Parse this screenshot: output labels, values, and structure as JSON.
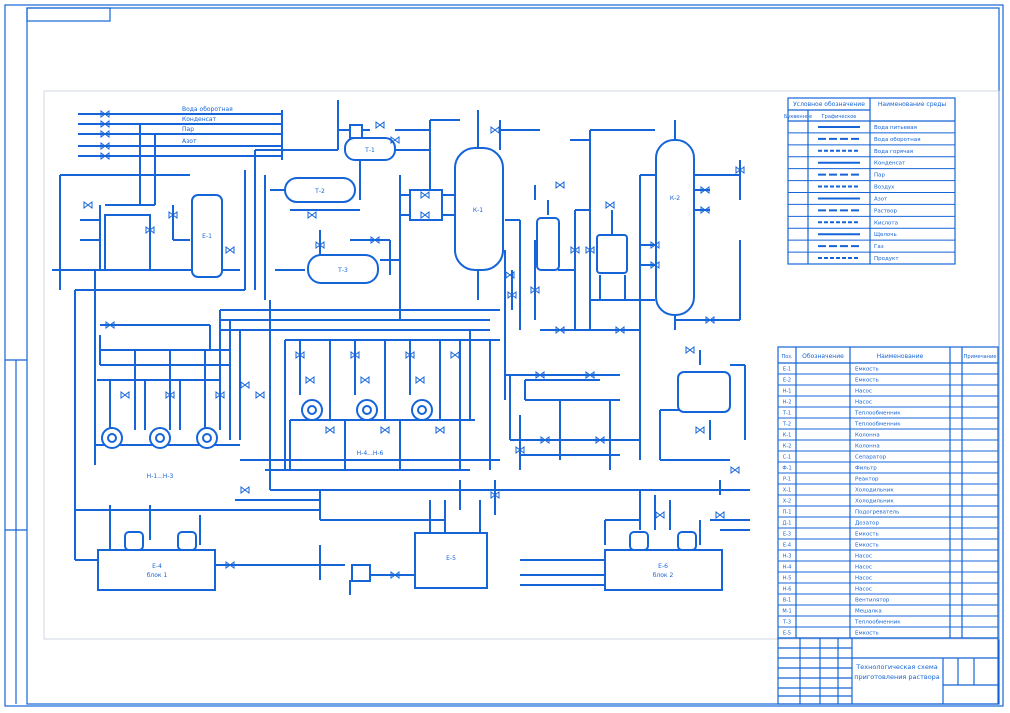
{
  "title_block": {
    "title_line1": "Технологическая схема",
    "title_line2": "приготовления раствора"
  },
  "legend": {
    "header_left": "Условное обозначение",
    "header_right": "Наименование среды",
    "sub_code": "Буквенное",
    "sub_graphic": "Графическое",
    "rows": [
      {
        "name": "Вода питьевая"
      },
      {
        "name": "Вода оборотная"
      },
      {
        "name": "Вода горячая"
      },
      {
        "name": "Конденсат"
      },
      {
        "name": "Пар"
      },
      {
        "name": "Воздух"
      },
      {
        "name": "Азот"
      },
      {
        "name": "Раствор"
      },
      {
        "name": "Кислота"
      },
      {
        "name": "Щелочь"
      },
      {
        "name": "Газ"
      },
      {
        "name": "Продукт"
      }
    ]
  },
  "spec": {
    "col_pos": "Поз.",
    "col_code": "Обозначение",
    "col_name": "Наименование",
    "col_note": "Примечание",
    "rows": [
      {
        "pos": "Е-1",
        "name": "Емкость"
      },
      {
        "pos": "Е-2",
        "name": "Емкость"
      },
      {
        "pos": "Н-1",
        "name": "Насос"
      },
      {
        "pos": "Н-2",
        "name": "Насос"
      },
      {
        "pos": "Т-1",
        "name": "Теплообменник"
      },
      {
        "pos": "Т-2",
        "name": "Теплообменник"
      },
      {
        "pos": "К-1",
        "name": "Колонна"
      },
      {
        "pos": "К-2",
        "name": "Колонна"
      },
      {
        "pos": "С-1",
        "name": "Сепаратор"
      },
      {
        "pos": "Ф-1",
        "name": "Фильтр"
      },
      {
        "pos": "Р-1",
        "name": "Реактор"
      },
      {
        "pos": "Х-1",
        "name": "Холодильник"
      },
      {
        "pos": "Х-2",
        "name": "Холодильник"
      },
      {
        "pos": "П-1",
        "name": "Подогреватель"
      },
      {
        "pos": "Д-1",
        "name": "Дозатор"
      },
      {
        "pos": "Е-3",
        "name": "Емкость"
      },
      {
        "pos": "Е-4",
        "name": "Емкость"
      },
      {
        "pos": "Н-3",
        "name": "Насос"
      },
      {
        "pos": "Н-4",
        "name": "Насос"
      },
      {
        "pos": "Н-5",
        "name": "Насос"
      },
      {
        "pos": "Н-6",
        "name": "Насос"
      },
      {
        "pos": "В-1",
        "name": "Вентилятор"
      },
      {
        "pos": "М-1",
        "name": "Мешалка"
      },
      {
        "pos": "Т-3",
        "name": "Теплообменник"
      },
      {
        "pos": "Е-5",
        "name": "Емкость"
      }
    ]
  },
  "labels": {
    "l1": "Вода оборотная",
    "l2": "Конденсат",
    "l3": "Пар",
    "l4": "Азот",
    "e1": "Е-1",
    "e2": "Е-2",
    "e3": "Е-3",
    "k1": "К-1",
    "k2": "К-2",
    "t1": "Т-1",
    "t2": "Т-2",
    "t3": "Т-3",
    "e4": "Е-4",
    "e5": "Е-5",
    "e6": "Е-6",
    "blk1": "блок 1",
    "blk2": "блок 2",
    "n13": "Н-1...Н-3",
    "n46": "Н-4...Н-6"
  }
}
